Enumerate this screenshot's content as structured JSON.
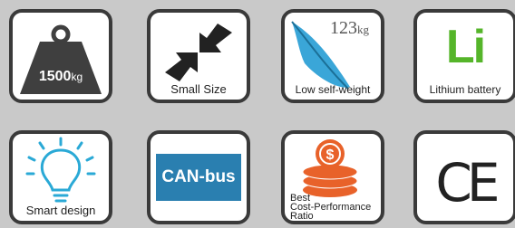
{
  "tiles": [
    {
      "id": "weight",
      "value": "1500",
      "unit": "kg",
      "icon": "weight-icon"
    },
    {
      "id": "size",
      "label": "Small Size",
      "icon": "compress-arrows-icon"
    },
    {
      "id": "self_weight",
      "value": "123",
      "unit": "kg",
      "label": "Low self-weight",
      "icon": "feather-icon"
    },
    {
      "id": "battery",
      "symbol": "Li",
      "label": "Lithium battery",
      "icon": "lithium-icon"
    },
    {
      "id": "smart",
      "label": "Smart design",
      "icon": "lightbulb-icon"
    },
    {
      "id": "canbus",
      "label": "CAN-bus",
      "icon": "canbus-icon"
    },
    {
      "id": "ratio",
      "lines": [
        "Best",
        "Cost-Performance",
        "Ratio"
      ],
      "icon": "coin-stack-icon"
    },
    {
      "id": "ce",
      "label": "CE",
      "icon": "ce-mark-icon"
    }
  ],
  "colors": {
    "background": "#c9c9c9",
    "border": "#3a3a3a",
    "weight_fill": "#3f3f3f",
    "arrow_fill": "#222222",
    "feather_blue": "#3aa6d8",
    "lithium_green": "#55b52a",
    "bulb_blue": "#2aa9d6",
    "canbus_blue": "#2a7fb0",
    "coin_orange": "#e8622a"
  }
}
